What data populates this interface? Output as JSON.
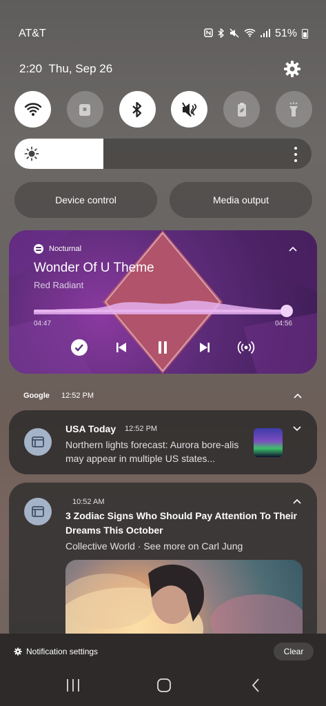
{
  "status_bar": {
    "carrier": "AT&T",
    "battery": "51%"
  },
  "header": {
    "time": "2:20",
    "date": "Thu, Sep 26"
  },
  "quick_settings": [
    {
      "name": "wifi",
      "state": "on"
    },
    {
      "name": "lock",
      "state": "off"
    },
    {
      "name": "bluetooth",
      "state": "on"
    },
    {
      "name": "sound-mute",
      "state": "on"
    },
    {
      "name": "power-saving",
      "state": "off"
    },
    {
      "name": "flashlight",
      "state": "off"
    }
  ],
  "brightness": {
    "level": 0.3
  },
  "pills": {
    "device_control": "Device control",
    "media_output": "Media output"
  },
  "media": {
    "app": "Nocturnal",
    "title": "Wonder Of U Theme",
    "artist": "Red Radiant",
    "current_time": "04:47",
    "total_time": "04:56",
    "progress": 0.98
  },
  "notifications": {
    "group_app": "Google",
    "group_time": "12:52 PM",
    "items": [
      {
        "source": "USA Today",
        "time": "12:52 PM",
        "body": "Northern lights forecast: Aurora bore-alis may appear in multiple US states..."
      },
      {
        "time": "10:52 AM",
        "title": "3 Zodiac Signs Who Should Pay Attention To Their Dreams This October",
        "subtitle": "Collective World · See more on Carl Jung"
      }
    ]
  },
  "footer": {
    "notification_settings": "Notification settings",
    "clear": "Clear"
  }
}
